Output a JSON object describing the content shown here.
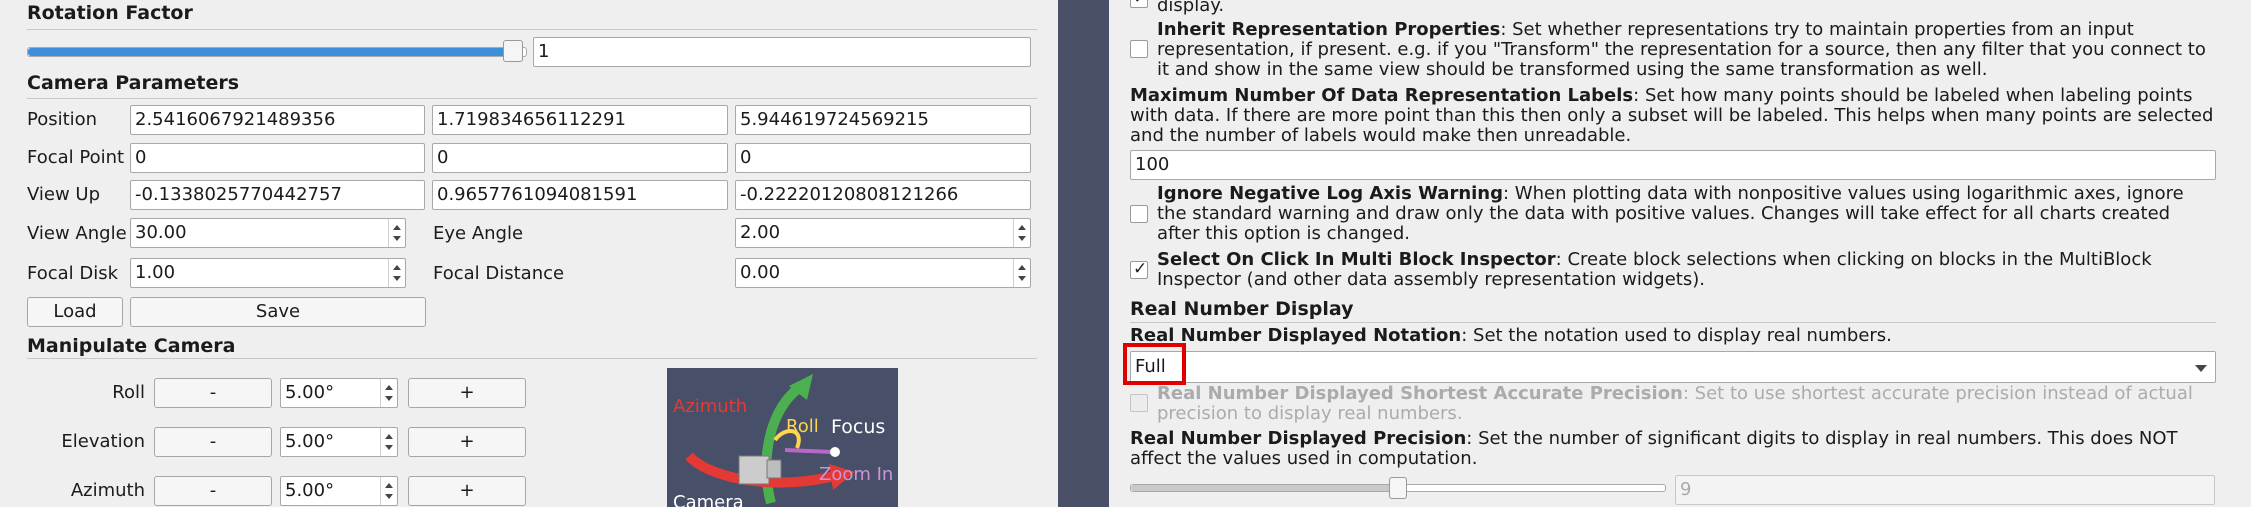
{
  "left": {
    "rotation_factor": {
      "title": "Rotation Factor",
      "value": "1",
      "slider_fraction": 0.98
    },
    "camera_parameters": {
      "title": "Camera Parameters",
      "position": {
        "label": "Position",
        "values": [
          "2.5416067921489356",
          "1.719834656112291",
          "5.944619724569215"
        ]
      },
      "focal_point": {
        "label": "Focal Point",
        "values": [
          "0",
          "0",
          "0"
        ]
      },
      "view_up": {
        "label": "View Up",
        "values": [
          "-0.1338025770442757",
          "0.9657761094081591",
          "-0.22220120808121266"
        ]
      },
      "view_angle": {
        "label": "View Angle",
        "value": "30.00"
      },
      "eye_angle": {
        "label": "Eye Angle",
        "value": "2.00"
      },
      "focal_disk": {
        "label": "Focal Disk",
        "value": "1.00"
      },
      "focal_distance": {
        "label": "Focal Distance",
        "value": "0.00"
      },
      "load_label": "Load",
      "save_label": "Save"
    },
    "manipulate_camera": {
      "title": "Manipulate Camera",
      "rows": [
        {
          "label": "Roll",
          "minus": "-",
          "value": "5.00°",
          "plus": "+"
        },
        {
          "label": "Elevation",
          "minus": "-",
          "value": "5.00°",
          "plus": "+"
        },
        {
          "label": "Azimuth",
          "minus": "-",
          "value": "5.00°",
          "plus": "+"
        }
      ],
      "widget": {
        "azimuth": "Azimuth",
        "roll": "Roll",
        "focus": "Focus",
        "zoom_in": "Zoom In",
        "camera": "Camera"
      }
    }
  },
  "right": {
    "top_fragment": "display.",
    "inherit": {
      "title": "Inherit Representation Properties",
      "text": ": Set whether representations try to maintain properties from an input representation, if present. e.g. if you \"Transform\" the representation for a source, then any filter that you connect to it and show in the same view should be transformed using the same transformation as well.",
      "checked": false
    },
    "max_labels": {
      "title": "Maximum Number Of Data Representation Labels",
      "text": ": Set how many points should be labeled when labeling points with data. If there are more point than this then only a subset will be labeled. This helps when many points are selected and the number of labels would make then unreadable.",
      "value": "100"
    },
    "ignore_neg": {
      "title": "Ignore Negative Log Axis Warning",
      "text": ": When plotting data with nonpositive values using logarithmic axes, ignore the standard warning and draw only the data with positive values. Changes will take effect for all charts created after this option is changed.",
      "checked": false
    },
    "select_click": {
      "title": "Select On Click In Multi Block Inspector",
      "text": ": Create block selections when clicking on blocks in the MultiBlock Inspector (and other data assembly representation widgets).",
      "checked": true
    },
    "real_number_display": {
      "title": "Real Number Display"
    },
    "notation": {
      "title": "Real Number Displayed Notation",
      "text": ": Set the notation used to display real numbers.",
      "value": "Full"
    },
    "shortest": {
      "title": "Real Number Displayed Shortest Accurate Precision",
      "text": ": Set to use shortest accurate precision instead of actual precision to display real numbers.",
      "checked": false
    },
    "precision": {
      "title": "Real Number Displayed Precision",
      "text": ": Set the number of significant digits to display in real numbers. This does NOT affect the values used in computation.",
      "value": "9",
      "slider_fraction": 0.5
    }
  },
  "colors": {
    "accent": "#3d8fd9",
    "highlight": "#e00000",
    "sidebar": "#4a5068"
  }
}
